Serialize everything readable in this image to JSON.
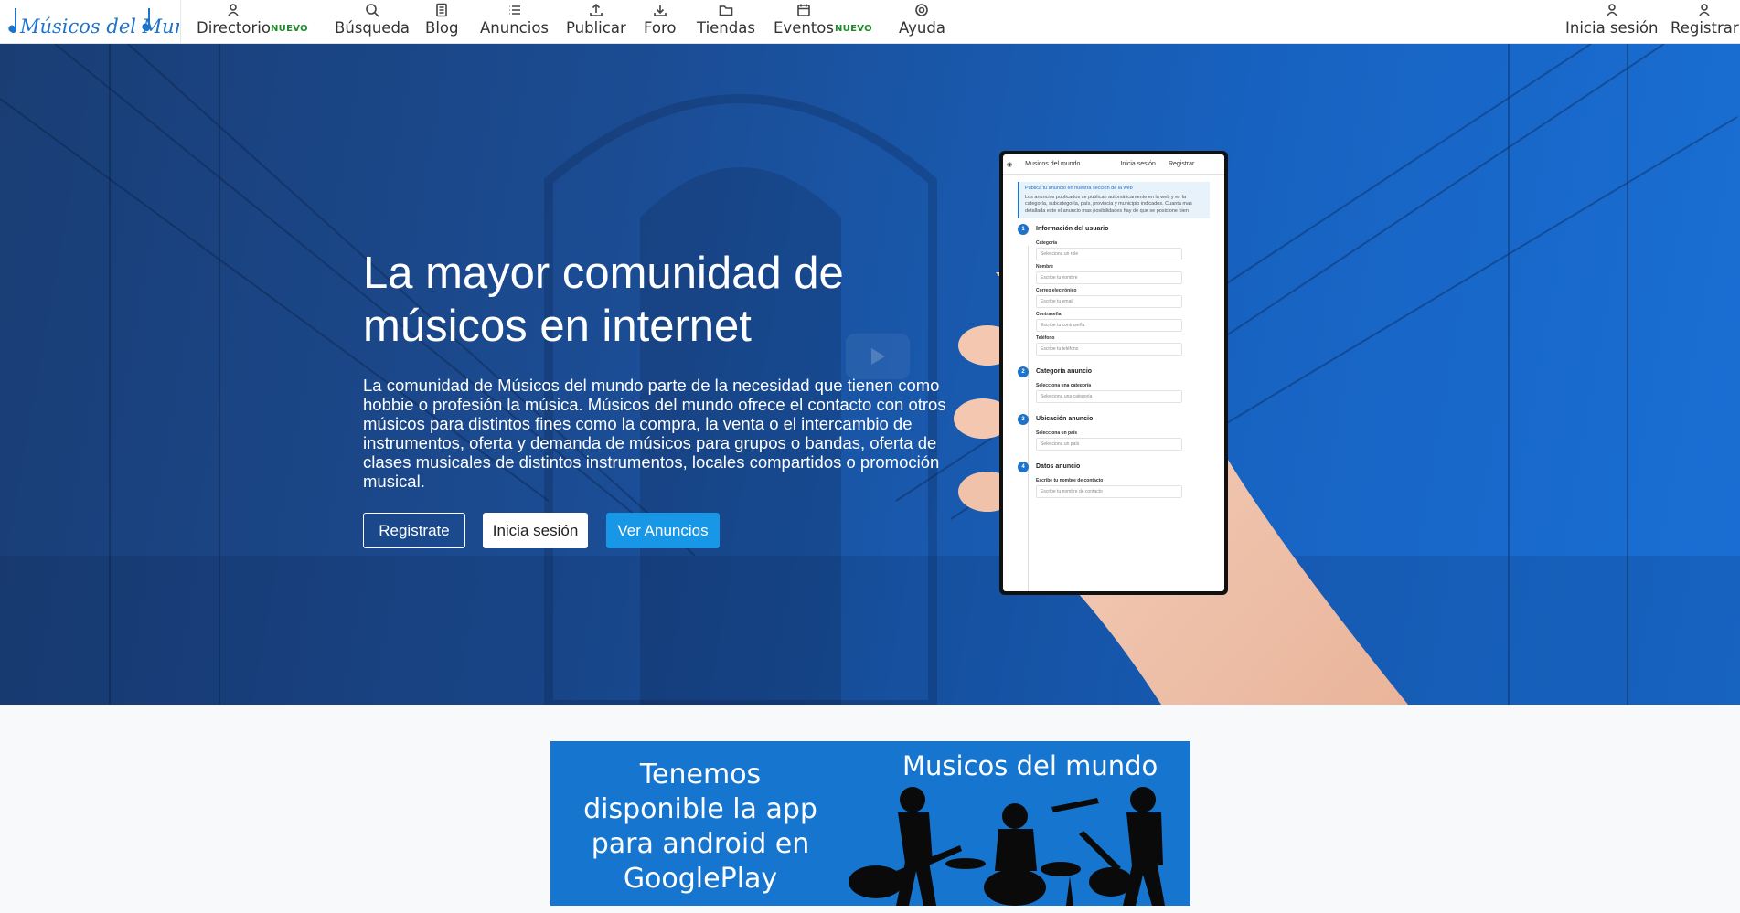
{
  "brand": {
    "name": "Músicos del Mundo"
  },
  "nav": {
    "items": [
      {
        "label": "Directorio",
        "icon": "user-icon",
        "badge": "NUEVO"
      },
      {
        "label": "Búsqueda",
        "icon": "search-icon"
      },
      {
        "label": "Blog",
        "icon": "document-icon"
      },
      {
        "label": "Anuncios",
        "icon": "list-icon"
      },
      {
        "label": "Publicar",
        "icon": "upload-icon"
      },
      {
        "label": "Foro",
        "icon": "download-icon"
      },
      {
        "label": "Tiendas",
        "icon": "folder-icon"
      },
      {
        "label": "Eventos",
        "icon": "calendar-icon",
        "badge": "NUEVO"
      },
      {
        "label": "Ayuda",
        "icon": "lifebuoy-icon"
      }
    ],
    "right": [
      {
        "label": "Inicia sesión",
        "icon": "user-icon"
      },
      {
        "label": "Registrar",
        "icon": "user-icon"
      }
    ]
  },
  "hero": {
    "title": "La mayor comunidad de músicos en internet",
    "text": "La comunidad de Músicos del mundo parte de la necesidad que tienen como hobbie o profesión la música. Músicos del mundo ofrece el contacto con otros músicos para distintos fines como la compra, la venta o el intercambio de instrumentos, oferta y demanda de músicos para grupos o bandas, oferta de clases musicales de distintos instrumentos, locales compartidos o promoción musical.",
    "buttons": {
      "register": "Registrate",
      "login": "Inicia sesión",
      "ads": "Ver Anuncios"
    }
  },
  "phone": {
    "app_title": "Musicos del mundo",
    "login": "Inicia sesión",
    "register": "Registrar",
    "note_title": "Publica tu anuncio en nuestra sección de la web",
    "note_text": "Los anuncios publicados se publican automáticamente en la web y en la categoría, subcategoría, país, provincia y municipio indicados. Cuanta mas detallada este el anuncio mas posibilidades hay de que se posicione bien",
    "sections": [
      {
        "num": "1",
        "title": "Información del usuario",
        "fields": [
          {
            "label": "Categoría",
            "value": "Selecciona un role"
          },
          {
            "label": "Nombre",
            "value": "Escribe tu nombre"
          },
          {
            "label": "Correo electrónico",
            "value": "Escribe tu email"
          },
          {
            "label": "Contraseña",
            "value": "Escribe tu contraseña"
          },
          {
            "label": "Teléfono",
            "value": "Escribe tu teléfono"
          }
        ]
      },
      {
        "num": "2",
        "title": "Categoría anuncio",
        "fields": [
          {
            "label": "Selecciona una categoría",
            "value": "Selecciona una categoría"
          }
        ]
      },
      {
        "num": "3",
        "title": "Ubicación anuncio",
        "fields": [
          {
            "label": "Selecciona un país",
            "value": "Selecciona un país"
          }
        ]
      },
      {
        "num": "4",
        "title": "Datos anuncio",
        "fields": [
          {
            "label": "Escribe tu nombre de contacto",
            "value": "Escribe tu nombre de contacto"
          }
        ]
      }
    ]
  },
  "banner": {
    "left_lines": [
      "Tenemos",
      "disponible la app",
      "para android en",
      "GooglePlay"
    ],
    "right_title": "Musicos del mundo"
  },
  "colors": {
    "hero_start": "#1a3d74",
    "hero_end": "#1a6fd4",
    "accent": "#1897e6",
    "badge": "#1f8a2c",
    "banner": "#1675cf"
  }
}
